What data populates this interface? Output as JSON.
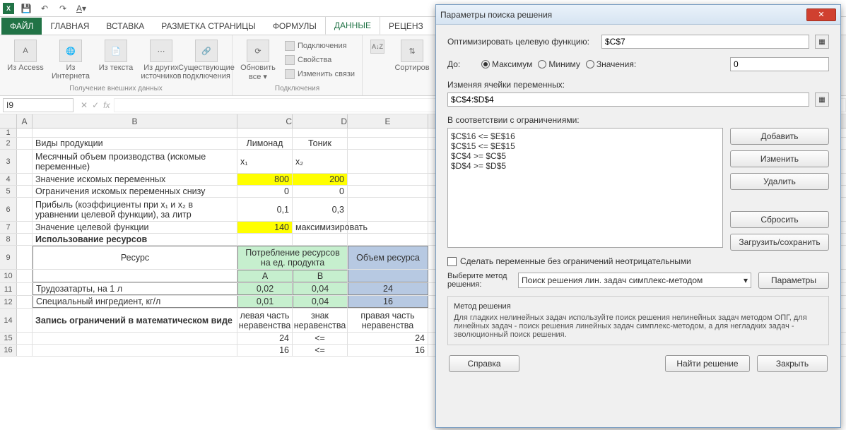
{
  "qat": {
    "app": "X"
  },
  "ribbon_tabs": {
    "file": "ФАЙЛ",
    "home": "ГЛАВНАЯ",
    "insert": "ВСТАВКА",
    "layout": "РАЗМЕТКА СТРАНИЦЫ",
    "formulas": "ФОРМУЛЫ",
    "data": "ДАННЫЕ",
    "review": "РЕЦЕНЗ"
  },
  "ribbon": {
    "ext_data": {
      "access": "Из Access",
      "web": "Из Интернета",
      "text": "Из текста",
      "other": "Из других источников",
      "existing": "Существующие подключения",
      "group": "Получение внешних данных"
    },
    "connections": {
      "refresh": "Обновить все ▾",
      "conn": "Подключения",
      "props": "Свойства",
      "edit": "Изменить связи",
      "group": "Подключения"
    },
    "sort": {
      "sort": "Сортиров"
    }
  },
  "namebox": "I9",
  "cols": {
    "A": "A",
    "B": "B",
    "C": "C",
    "D": "D",
    "E": "E"
  },
  "sheet": {
    "r2": {
      "b": "Виды продукции",
      "c": "Лимонад",
      "d": "Тоник"
    },
    "r3": {
      "b": "Месячный объем производства (искомые переменные)",
      "c": "x₁",
      "d": "x₂"
    },
    "r4": {
      "b": "Значение искомых переменных",
      "c": "800",
      "d": "200"
    },
    "r5": {
      "b": "Ограничения искомых переменных снизу",
      "c": "0",
      "d": "0"
    },
    "r6": {
      "b": "Прибыль (коэффициенты при x₁ и x₂ в уравнении целевой функции), за литр",
      "c": "0,1",
      "d": "0,3"
    },
    "r7": {
      "b": "Значение целевой функции",
      "c": "140",
      "d": "максимизировать"
    },
    "r8": {
      "b": "Использование ресурсов"
    },
    "r9": {
      "b": "Ресурс",
      "cd": "Потребление ресурсов на ед. продукта",
      "e": "Объем ресурса"
    },
    "r10": {
      "c": "A",
      "d": "B"
    },
    "r11": {
      "b": "Трудозатарты, на 1 л",
      "c": "0,02",
      "d": "0,04",
      "e": "24"
    },
    "r12": {
      "b": "Специальный ингредиент, кг/л",
      "c": "0,01",
      "d": "0,04",
      "e": "16"
    },
    "r14": {
      "b": "Запись ограничений в математическом виде",
      "c": "левая часть неравенства",
      "d": "знак неравенства",
      "e": "правая часть неравенства"
    },
    "r15": {
      "c": "24",
      "d": "<=",
      "e": "24"
    },
    "r16": {
      "c": "16",
      "d": "<=",
      "e": "16"
    }
  },
  "rownums": [
    "1",
    "2",
    "3",
    "4",
    "5",
    "6",
    "7",
    "8",
    "9",
    "10",
    "11",
    "12",
    "14",
    "15",
    "16"
  ],
  "dialog": {
    "title": "Параметры поиска решения",
    "objective_lbl": "Оптимизировать целевую функцию:",
    "objective_val": "$C$7",
    "to_lbl": "До:",
    "opt_max": "Максимум",
    "opt_min": "Миниму",
    "opt_val": "Значения:",
    "opt_val_input": "0",
    "vars_lbl": "Изменяя ячейки переменных:",
    "vars_val": "$C$4:$D$4",
    "constraints_lbl": "В соответствии с ограничениями:",
    "constraints": [
      "$C$16 <= $E$16",
      "$C$15 <= $E$15",
      "$C$4 >= $C$5",
      "$D$4 >= $D$5"
    ],
    "btn_add": "Добавить",
    "btn_change": "Изменить",
    "btn_delete": "Удалить",
    "btn_reset": "Сбросить",
    "btn_loadsave": "Загрузить/сохранить",
    "chk_nonneg": "Сделать переменные без ограничений неотрицательными",
    "method_lbl": "Выберите метод решения:",
    "method_val": "Поиск решения лин. задач симплекс-методом",
    "btn_params": "Параметры",
    "desc_title": "Метод решения",
    "desc_text": "Для гладких нелинейных задач используйте поиск решения нелинейных задач методом ОПГ, для линейных задач - поиск решения линейных задач симплекс-методом, а для негладких задач - эволюционный поиск решения.",
    "btn_help": "Справка",
    "btn_solve": "Найти решение",
    "btn_close": "Закрыть"
  }
}
